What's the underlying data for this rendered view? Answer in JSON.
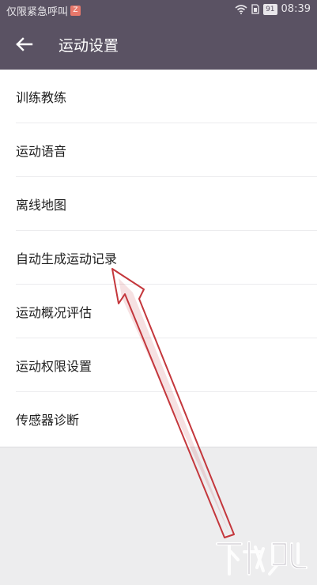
{
  "status_bar": {
    "left_text": "仅限紧急呼叫",
    "badge": "Z",
    "battery": "91",
    "time": "08:39"
  },
  "app_bar": {
    "title": "运动设置"
  },
  "items": [
    {
      "label": "训练教练"
    },
    {
      "label": "运动语音"
    },
    {
      "label": "离线地图"
    },
    {
      "label": "自动生成运动记录"
    },
    {
      "label": "运动概况评估"
    },
    {
      "label": "运动权限设置"
    },
    {
      "label": "传感器诊断"
    }
  ],
  "colors": {
    "header": "#5a5263",
    "background": "#ededee",
    "arrow": "#c4373c"
  },
  "icons": {
    "back": "arrow-left-icon",
    "wifi": "wifi-icon",
    "sim": "sim-card-icon",
    "battery": "battery-icon",
    "watermark": "xiazaiba-watermark-logo"
  }
}
